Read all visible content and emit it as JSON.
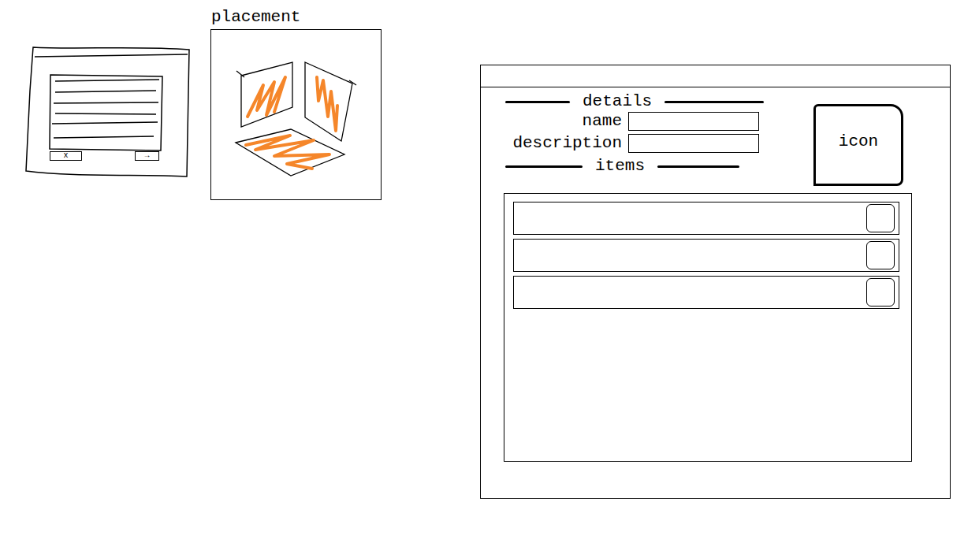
{
  "thumbnail": {
    "buttons": [
      "x",
      "→"
    ]
  },
  "placement": {
    "title": "placement"
  },
  "window": {
    "details_heading": "details",
    "fields": [
      {
        "label": "name",
        "value": ""
      },
      {
        "label": "description",
        "value": ""
      }
    ],
    "items_heading": "items",
    "icon": "icon",
    "items": [
      {
        "text": ""
      },
      {
        "text": ""
      },
      {
        "text": ""
      }
    ]
  }
}
